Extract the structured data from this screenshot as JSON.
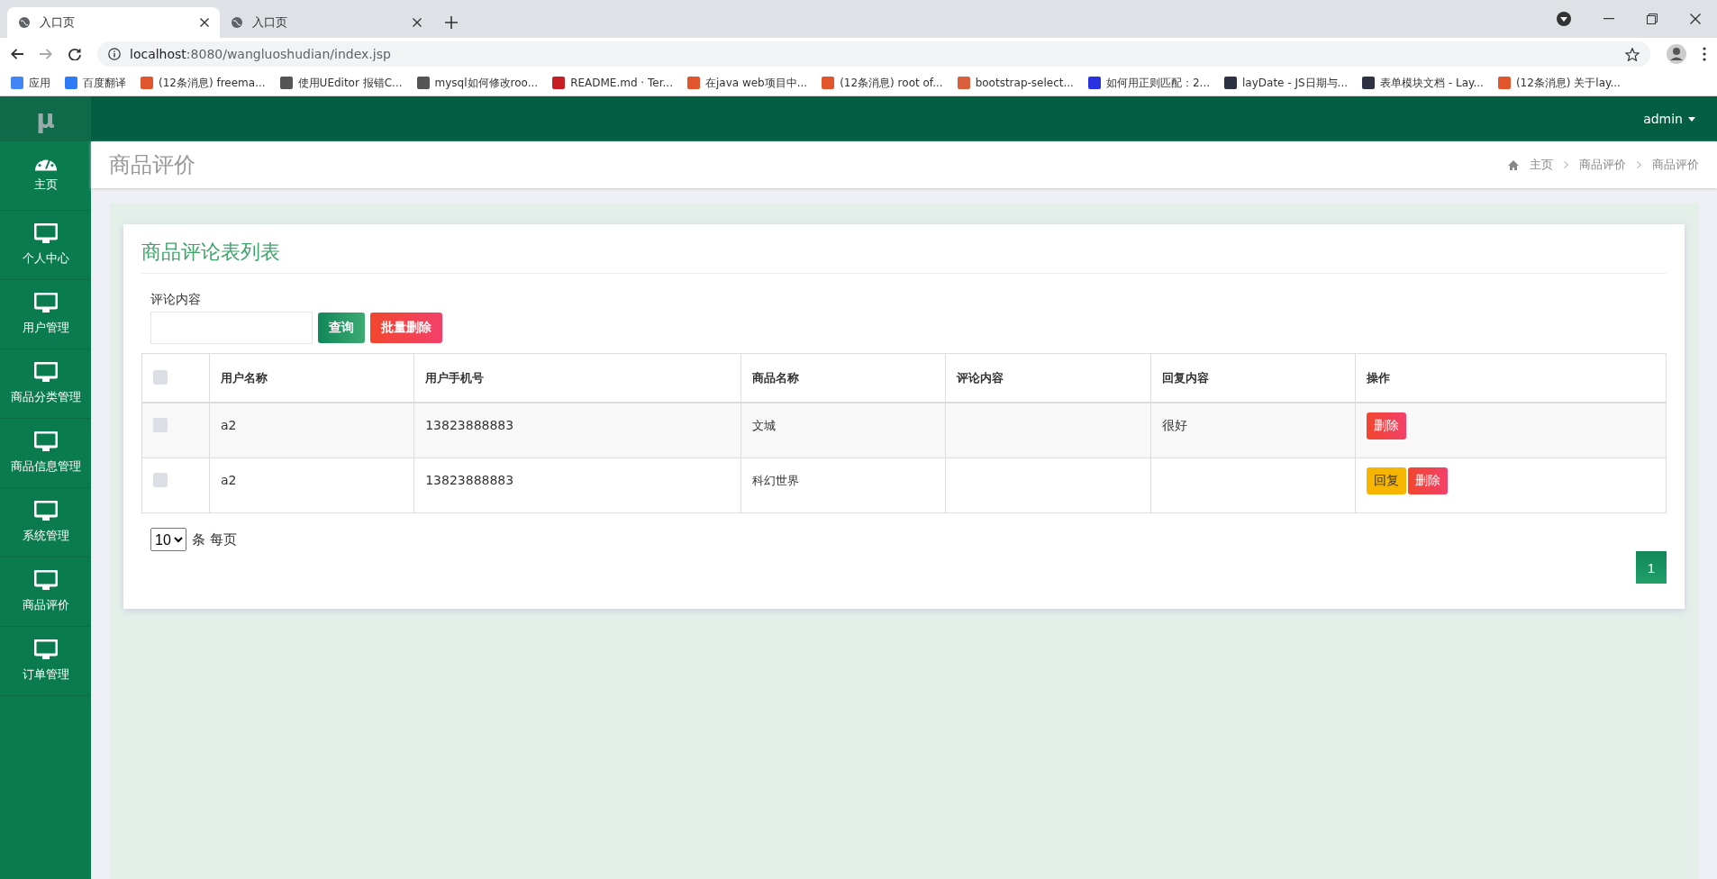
{
  "browser": {
    "tabs": [
      {
        "title": "入口页",
        "selected": true
      },
      {
        "title": "入口页",
        "selected": false
      }
    ],
    "url": {
      "host": "localhost",
      "rest": ":8080/wangluoshudian/index.jsp"
    },
    "bookmarks": [
      {
        "label": "应用",
        "color": "#4285f4"
      },
      {
        "label": "百度翻译",
        "color": "#2e7bf6"
      },
      {
        "label": "(12条消息) freema...",
        "color": "#e0552c"
      },
      {
        "label": "使用UEditor 报错C...",
        "color": "#555555"
      },
      {
        "label": "mysql如何修改roo...",
        "color": "#555555"
      },
      {
        "label": "README.md · Ter...",
        "color": "#c71d23"
      },
      {
        "label": "在java web项目中...",
        "color": "#e0552c"
      },
      {
        "label": "(12条消息) root of...",
        "color": "#e0552c"
      },
      {
        "label": "bootstrap-select...",
        "color": "#d9603b"
      },
      {
        "label": "如何用正则匹配：2...",
        "color": "#2932e1"
      },
      {
        "label": "layDate - JS日期与...",
        "color": "#2d3142"
      },
      {
        "label": "表单模块文档 - Lay...",
        "color": "#2d3142"
      },
      {
        "label": "(12条消息) 关于lay...",
        "color": "#e0552c"
      }
    ]
  },
  "logo": "μ",
  "user_menu": "admin",
  "sidebar": {
    "items": [
      {
        "label": "主页",
        "kind": "dashboard"
      },
      {
        "label": "个人中心",
        "kind": "monitor"
      },
      {
        "label": "用户管理",
        "kind": "monitor"
      },
      {
        "label": "商品分类管理",
        "kind": "monitor"
      },
      {
        "label": "商品信息管理",
        "kind": "monitor"
      },
      {
        "label": "系统管理",
        "kind": "monitor"
      },
      {
        "label": "商品评价",
        "kind": "monitor"
      },
      {
        "label": "订单管理",
        "kind": "monitor"
      }
    ]
  },
  "page_title": "商品评价",
  "breadcrumb": [
    "主页",
    "商品评价",
    "商品评价"
  ],
  "card": {
    "title": "商品评论表列表",
    "search": {
      "label": "评论内容"
    },
    "buttons": [
      {
        "label": "查询",
        "kind": "query"
      },
      {
        "label": "批量删除",
        "kind": "danger"
      }
    ],
    "table": {
      "header_checked": false,
      "columns": [
        "用户名称",
        "用户手机号",
        "商品名称",
        "评论内容",
        "回复内容",
        "操作"
      ],
      "rows": [
        {
          "checked": false,
          "user": "a2",
          "phone": "13823888883",
          "product": "文城",
          "reply": "很好",
          "actions": [
            {
              "label": "删除",
              "kind": "delete"
            }
          ]
        },
        {
          "checked": false,
          "user": "a2",
          "phone": "13823888883",
          "product": "科幻世界",
          "actions": [
            {
              "label": "回复",
              "kind": "reply"
            },
            {
              "label": "删除",
              "kind": "delete"
            }
          ]
        }
      ]
    },
    "page_size": "10",
    "page_size_label": "条 每页",
    "pages": [
      {
        "label": "1",
        "selected": true
      }
    ]
  }
}
